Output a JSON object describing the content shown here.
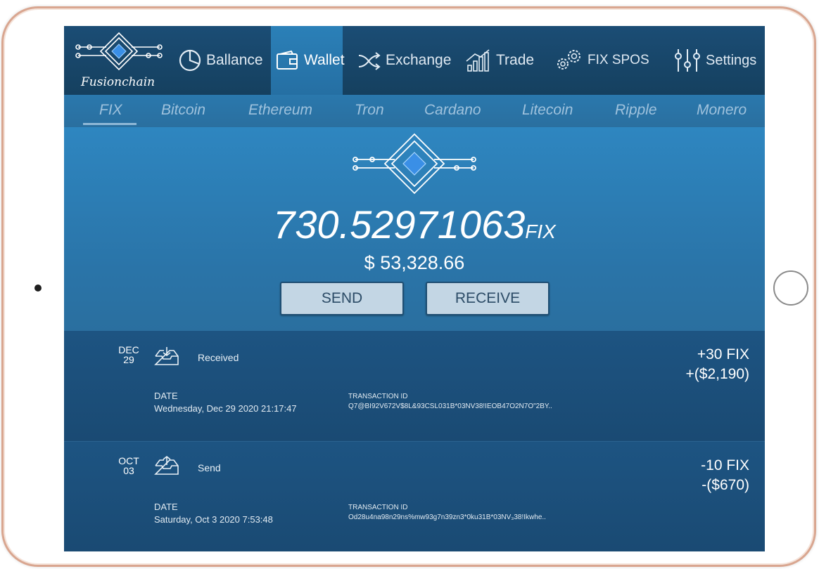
{
  "app": {
    "logo_text": "Fusionchain"
  },
  "nav": {
    "items": [
      {
        "label": "Ballance",
        "icon": "pie-chart-icon"
      },
      {
        "label": "Wallet",
        "icon": "wallet-icon",
        "active": true
      },
      {
        "label": "Exchange",
        "icon": "shuffle-icon"
      },
      {
        "label": "Trade",
        "icon": "chart-growth-icon"
      },
      {
        "label": "FIX SPOS",
        "icon": "gears-icon"
      },
      {
        "label": "Settings",
        "icon": "sliders-icon"
      }
    ]
  },
  "coins": [
    "FIX",
    "Bitcoin",
    "Ethereum",
    "Tron",
    "Cardano",
    "Litecoin",
    "Ripple",
    "Monero"
  ],
  "wallet": {
    "balance": "730.52971063",
    "unit": "FIX",
    "usd": "$ 53,328.66",
    "send_label": "SEND",
    "receive_label": "RECEIVE"
  },
  "transactions": [
    {
      "month": "DEC",
      "day": "29",
      "type": "Received",
      "icon": "inbox-download-icon",
      "date_label": "DATE",
      "date": "Wednesday, Dec 29 2020 21:17:47",
      "txid_label": "TRANSACTION ID",
      "txid": "Q7@BI92V672V$8L&93CSL031B*03NV38!IEOB47O2N7O\"2BY..",
      "amount": "+30 FIX",
      "usd": "+($2,190)"
    },
    {
      "month": "OCT",
      "day": "03",
      "type": "Send",
      "icon": "inbox-upload-icon",
      "date_label": "DATE",
      "date": "Saturday, Oct 3 2020 7:53:48",
      "txid_label": "TRANSACTION ID",
      "txid": "Od28u4na98n29ns%mw93g7n39zn3*0ku31B*03NV₃38!Ikwhe..",
      "amount": "-10 FIX",
      "usd": "-($670)"
    }
  ],
  "colors": {
    "accent": "#2e86c0",
    "nav_bg": "#1b4d75",
    "button_bg": "#c3d6e4",
    "frame": "#d9a690"
  }
}
